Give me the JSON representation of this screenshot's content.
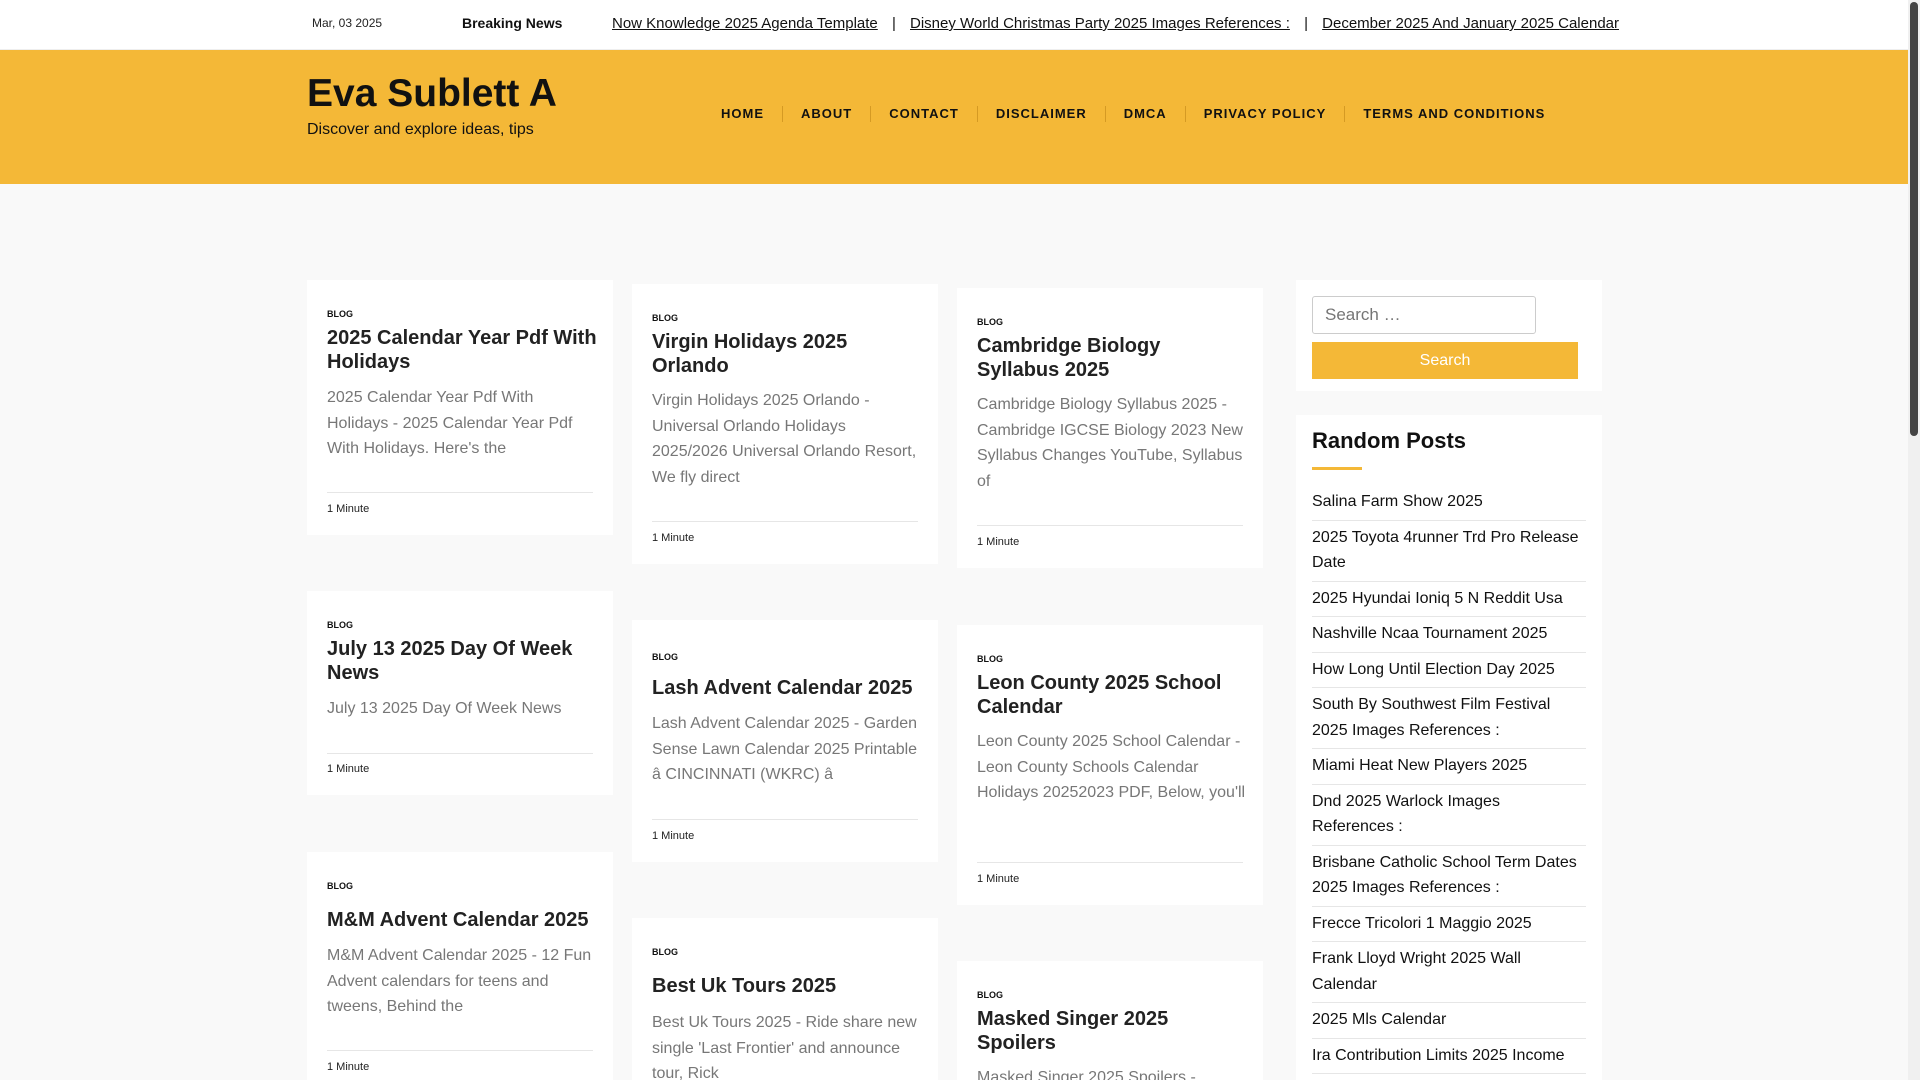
{
  "topbar": {
    "date": "Mar, 03 2025",
    "breaking_label": "Breaking News",
    "ticker": [
      " Now Knowledge 2025 Agenda Template",
      "Disney World Christmas Party 2025 Images References :",
      "December 2025 And January 2025 Calendar"
    ],
    "separator": "|"
  },
  "header": {
    "site_title": "Eva Sublett A",
    "site_desc": "Discover and explore ideas, tips",
    "nav": [
      "HOME",
      "ABOUT",
      "CONTACT",
      "DISCLAIMER",
      "DMCA",
      "PRIVACY POLICY",
      "TERMS AND CONDITIONS"
    ]
  },
  "posts": [
    {
      "category": "BLOG",
      "title": "2025 Calendar Year Pdf With Holidays",
      "excerpt": "2025 Calendar Year Pdf With Holidays - 2025 Calendar Year Pdf With Holidays. Here's the",
      "read_time": "1 Minute"
    },
    {
      "category": "BLOG",
      "title": "July 13 2025 Day Of Week News",
      "excerpt": "July 13 2025 Day Of Week News",
      "read_time": "1 Minute"
    },
    {
      "category": "BLOG",
      "title": "M&M Advent Calendar 2025",
      "excerpt": "M&M Advent Calendar 2025 - 12 Fun Advent calendars for teens and tweens, Behind the",
      "read_time": "1 Minute"
    },
    {
      "category": "BLOG",
      "title": "Virgin Holidays 2025 Orlando",
      "excerpt": "Virgin Holidays 2025 Orlando - Universal Orlando Holidays 2025/2026 Universal Orlando Resort, We fly direct",
      "read_time": "1 Minute"
    },
    {
      "category": "BLOG",
      "title": "Lash Advent Calendar 2025",
      "excerpt": "Lash Advent Calendar 2025 - Garden Sense Lawn Calendar 2025 Printable â CINCINNATI (WKRC) â",
      "read_time": "1 Minute"
    },
    {
      "category": "BLOG",
      "title": "Best Uk Tours 2025",
      "excerpt": "Best Uk Tours 2025 - Ride share new single 'Last Frontier' and announce tour, Rick",
      "read_time": "1 Minute"
    },
    {
      "category": "BLOG",
      "title": "Cambridge Biology Syllabus 2025",
      "excerpt": "Cambridge Biology Syllabus 2025 - Cambridge IGCSE Biology 2023 New Syllabus Changes YouTube, Syllabus of",
      "read_time": "1 Minute"
    },
    {
      "category": "BLOG",
      "title": "Leon County 2025 School Calendar",
      "excerpt": "Leon County 2025 School Calendar - Leon County Schools Calendar Holidays 20252023 PDF, Below, you'll",
      "read_time": "1 Minute"
    },
    {
      "category": "BLOG",
      "title": "Masked Singer 2025 Spoilers",
      "excerpt": "Masked Singer 2025 Spoilers -",
      "read_time": ""
    }
  ],
  "sidebar": {
    "search_placeholder": "Search …",
    "search_button": "Search",
    "random_title": "Random Posts",
    "random_posts": [
      "Salina Farm Show 2025",
      "2025 Toyota 4runner Trd Pro Release Date",
      "2025 Hyundai Ioniq 5 N Reddit Usa",
      "Nashville Ncaa Tournament 2025",
      "How Long Until Election Day 2025",
      "South By Southwest Film Festival 2025 Images References :",
      "Miami Heat New Players 2025",
      "Dnd 2025 Warlock Images References :",
      "Brisbane Catholic School Term Dates 2025 Images References :",
      "Frecce Tricolori 1 Maggio 2025",
      "Frank Lloyd Wright 2025 Wall Calendar",
      "2025 Mls Calendar",
      "Ira Contribution Limits 2025 Income"
    ]
  },
  "colors": {
    "accent": "#f4b837",
    "background": "#f9f9f9",
    "card": "#ffffff"
  }
}
